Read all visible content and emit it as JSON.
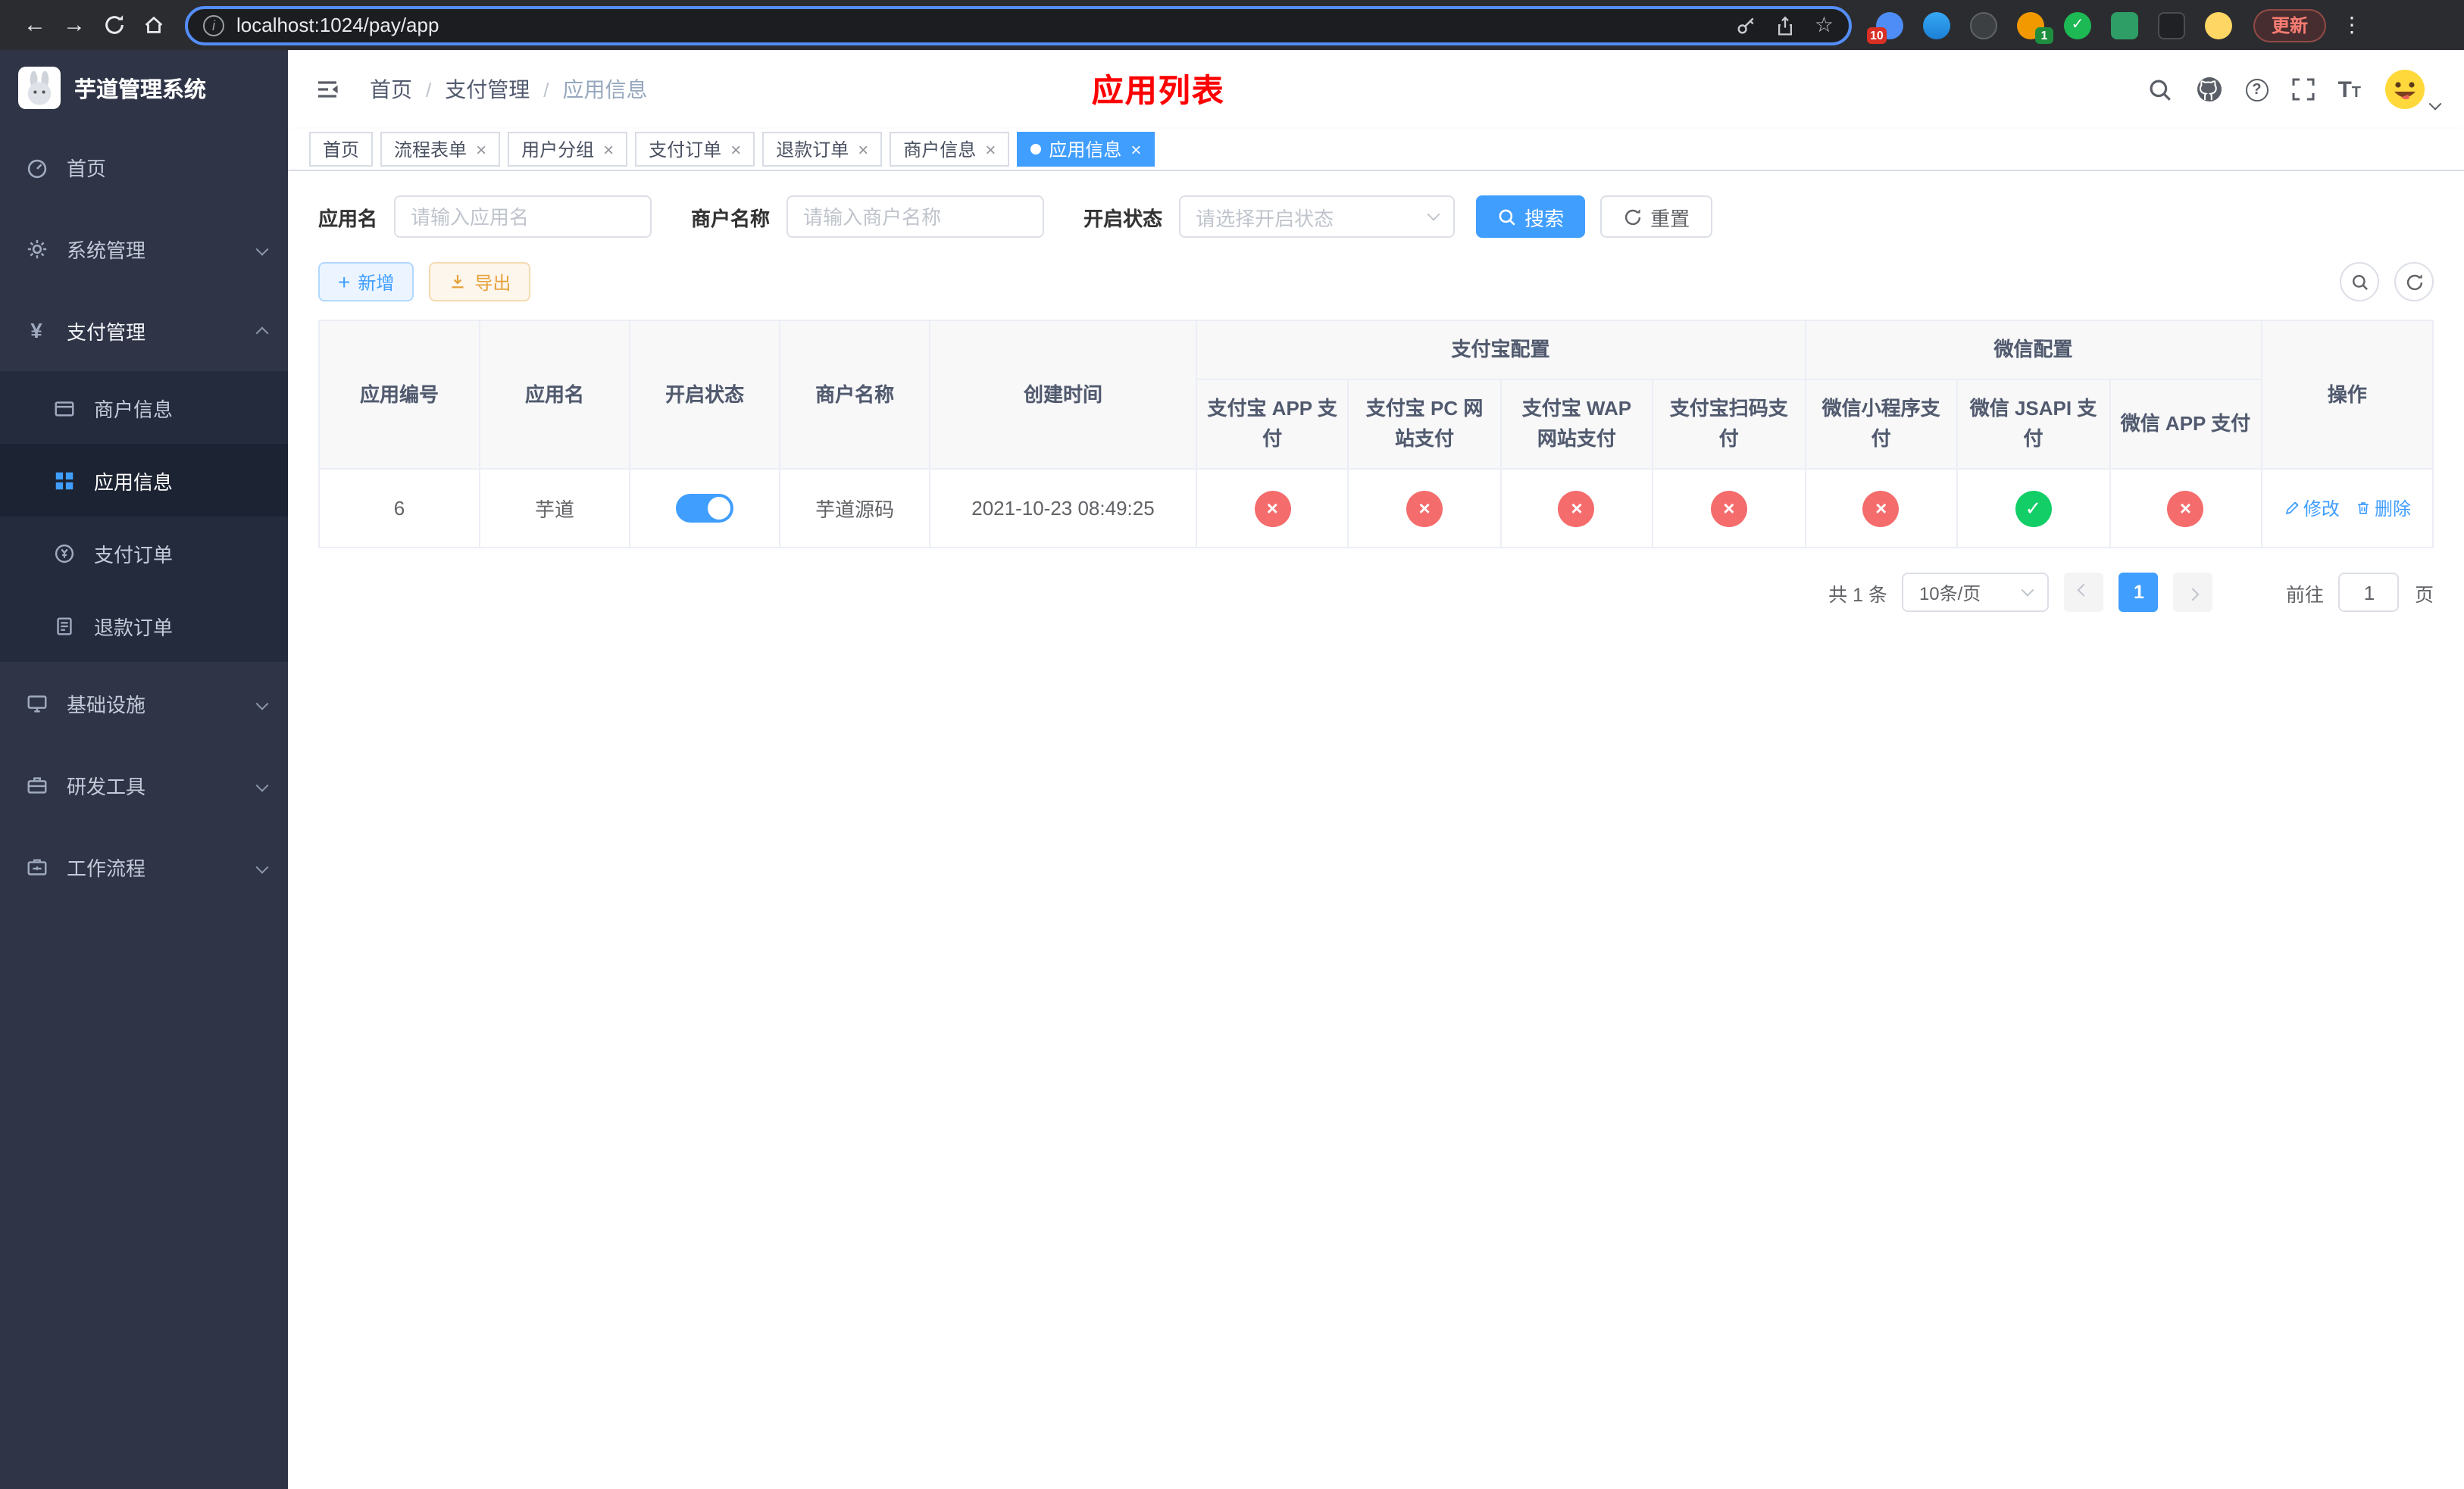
{
  "browser": {
    "url": "localhost:1024/pay/app",
    "update_label": "更新",
    "extension_badges": {
      "first": "10",
      "second": "1"
    }
  },
  "icons": {
    "close": "×",
    "check": "✓",
    "cross": "×",
    "plus": "+",
    "back": "←",
    "forward": "→",
    "star": "☆",
    "dots": "⋮",
    "info": "i",
    "currency": "¥",
    "question": "?",
    "text_size": "T"
  },
  "sidebar": {
    "logo_title": "芋道管理系统",
    "active_item": "应用信息",
    "menu": {
      "home": "首页",
      "system": "系统管理",
      "payment": "支付管理",
      "merchant_info": "商户信息",
      "app_info": "应用信息",
      "pay_order": "支付订单",
      "refund_order": "退款订单",
      "infra": "基础设施",
      "devtools": "研发工具",
      "workflow": "工作流程"
    }
  },
  "header": {
    "breadcrumb": {
      "home": "首页",
      "sep": "/",
      "section": "支付管理",
      "current": "应用信息"
    },
    "annotation": "应用列表"
  },
  "tabs": {
    "t0": {
      "label": "首页",
      "closable": false,
      "active": false
    },
    "t1": {
      "label": "流程表单",
      "closable": true,
      "active": false
    },
    "t2": {
      "label": "用户分组",
      "closable": true,
      "active": false
    },
    "t3": {
      "label": "支付订单",
      "closable": true,
      "active": false
    },
    "t4": {
      "label": "退款订单",
      "closable": true,
      "active": false
    },
    "t5": {
      "label": "商户信息",
      "closable": true,
      "active": false
    },
    "t6": {
      "label": "应用信息",
      "closable": true,
      "active": true
    }
  },
  "filter": {
    "app_name_label": "应用名",
    "app_name_placeholder": "请输入应用名",
    "merchant_label": "商户名称",
    "merchant_placeholder": "请输入商户名称",
    "status_label": "开启状态",
    "status_placeholder": "请选择开启状态",
    "search_label": "搜索",
    "reset_label": "重置"
  },
  "toolbar": {
    "add_label": "新增",
    "export_label": "导出"
  },
  "table": {
    "groups": {
      "alipay": "支付宝配置",
      "wechat": "微信配置"
    },
    "columns": {
      "id": "应用编号",
      "name": "应用名",
      "status": "开启状态",
      "merchant": "商户名称",
      "created": "创建时间",
      "alipay_app": "支付宝 APP 支付",
      "alipay_pc": "支付宝 PC 网站支付",
      "alipay_wap": "支付宝 WAP 网站支付",
      "alipay_qr": "支付宝扫码支付",
      "wx_mini": "微信小程序支付",
      "wx_jsapi": "微信 JSAPI 支付",
      "wx_app": "微信 APP 支付",
      "actions": "操作"
    },
    "row": {
      "id": "6",
      "name": "芋道",
      "status_on": true,
      "merchant": "芋道源码",
      "created": "2021-10-23 08:49:25",
      "configs": {
        "alipay_app": false,
        "alipay_pc": false,
        "alipay_wap": false,
        "alipay_qr": false,
        "wx_mini": false,
        "wx_jsapi": true,
        "wx_app": false
      },
      "edit": "修改",
      "delete": "删除"
    }
  },
  "pagination": {
    "total": "共 1 条",
    "size": "10条/页",
    "page": "1",
    "goto": "前往",
    "goto_value": "1",
    "unit": "页"
  },
  "colors": {
    "primary": "#409eff",
    "danger": "#f56c6c",
    "success": "#13ce66",
    "warning": "#e6a23c",
    "annotation_red": "#ff0000",
    "sidebar_bg": "#2f3447",
    "submenu_bg": "#242b3d"
  }
}
